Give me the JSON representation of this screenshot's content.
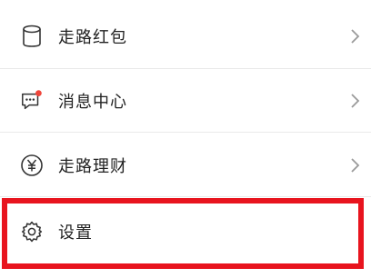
{
  "menu": {
    "items": [
      {
        "label": "走路红包",
        "icon": "wallet-icon"
      },
      {
        "label": "消息中心",
        "icon": "message-icon",
        "badge": true
      },
      {
        "label": "走路理财",
        "icon": "yuan-icon"
      },
      {
        "label": "设置",
        "icon": "gear-icon"
      }
    ]
  },
  "colors": {
    "highlight": "#e8141e",
    "badge": "#f0453a",
    "text": "#222222",
    "icon": "#333333",
    "chevron": "#9a9a9a"
  }
}
